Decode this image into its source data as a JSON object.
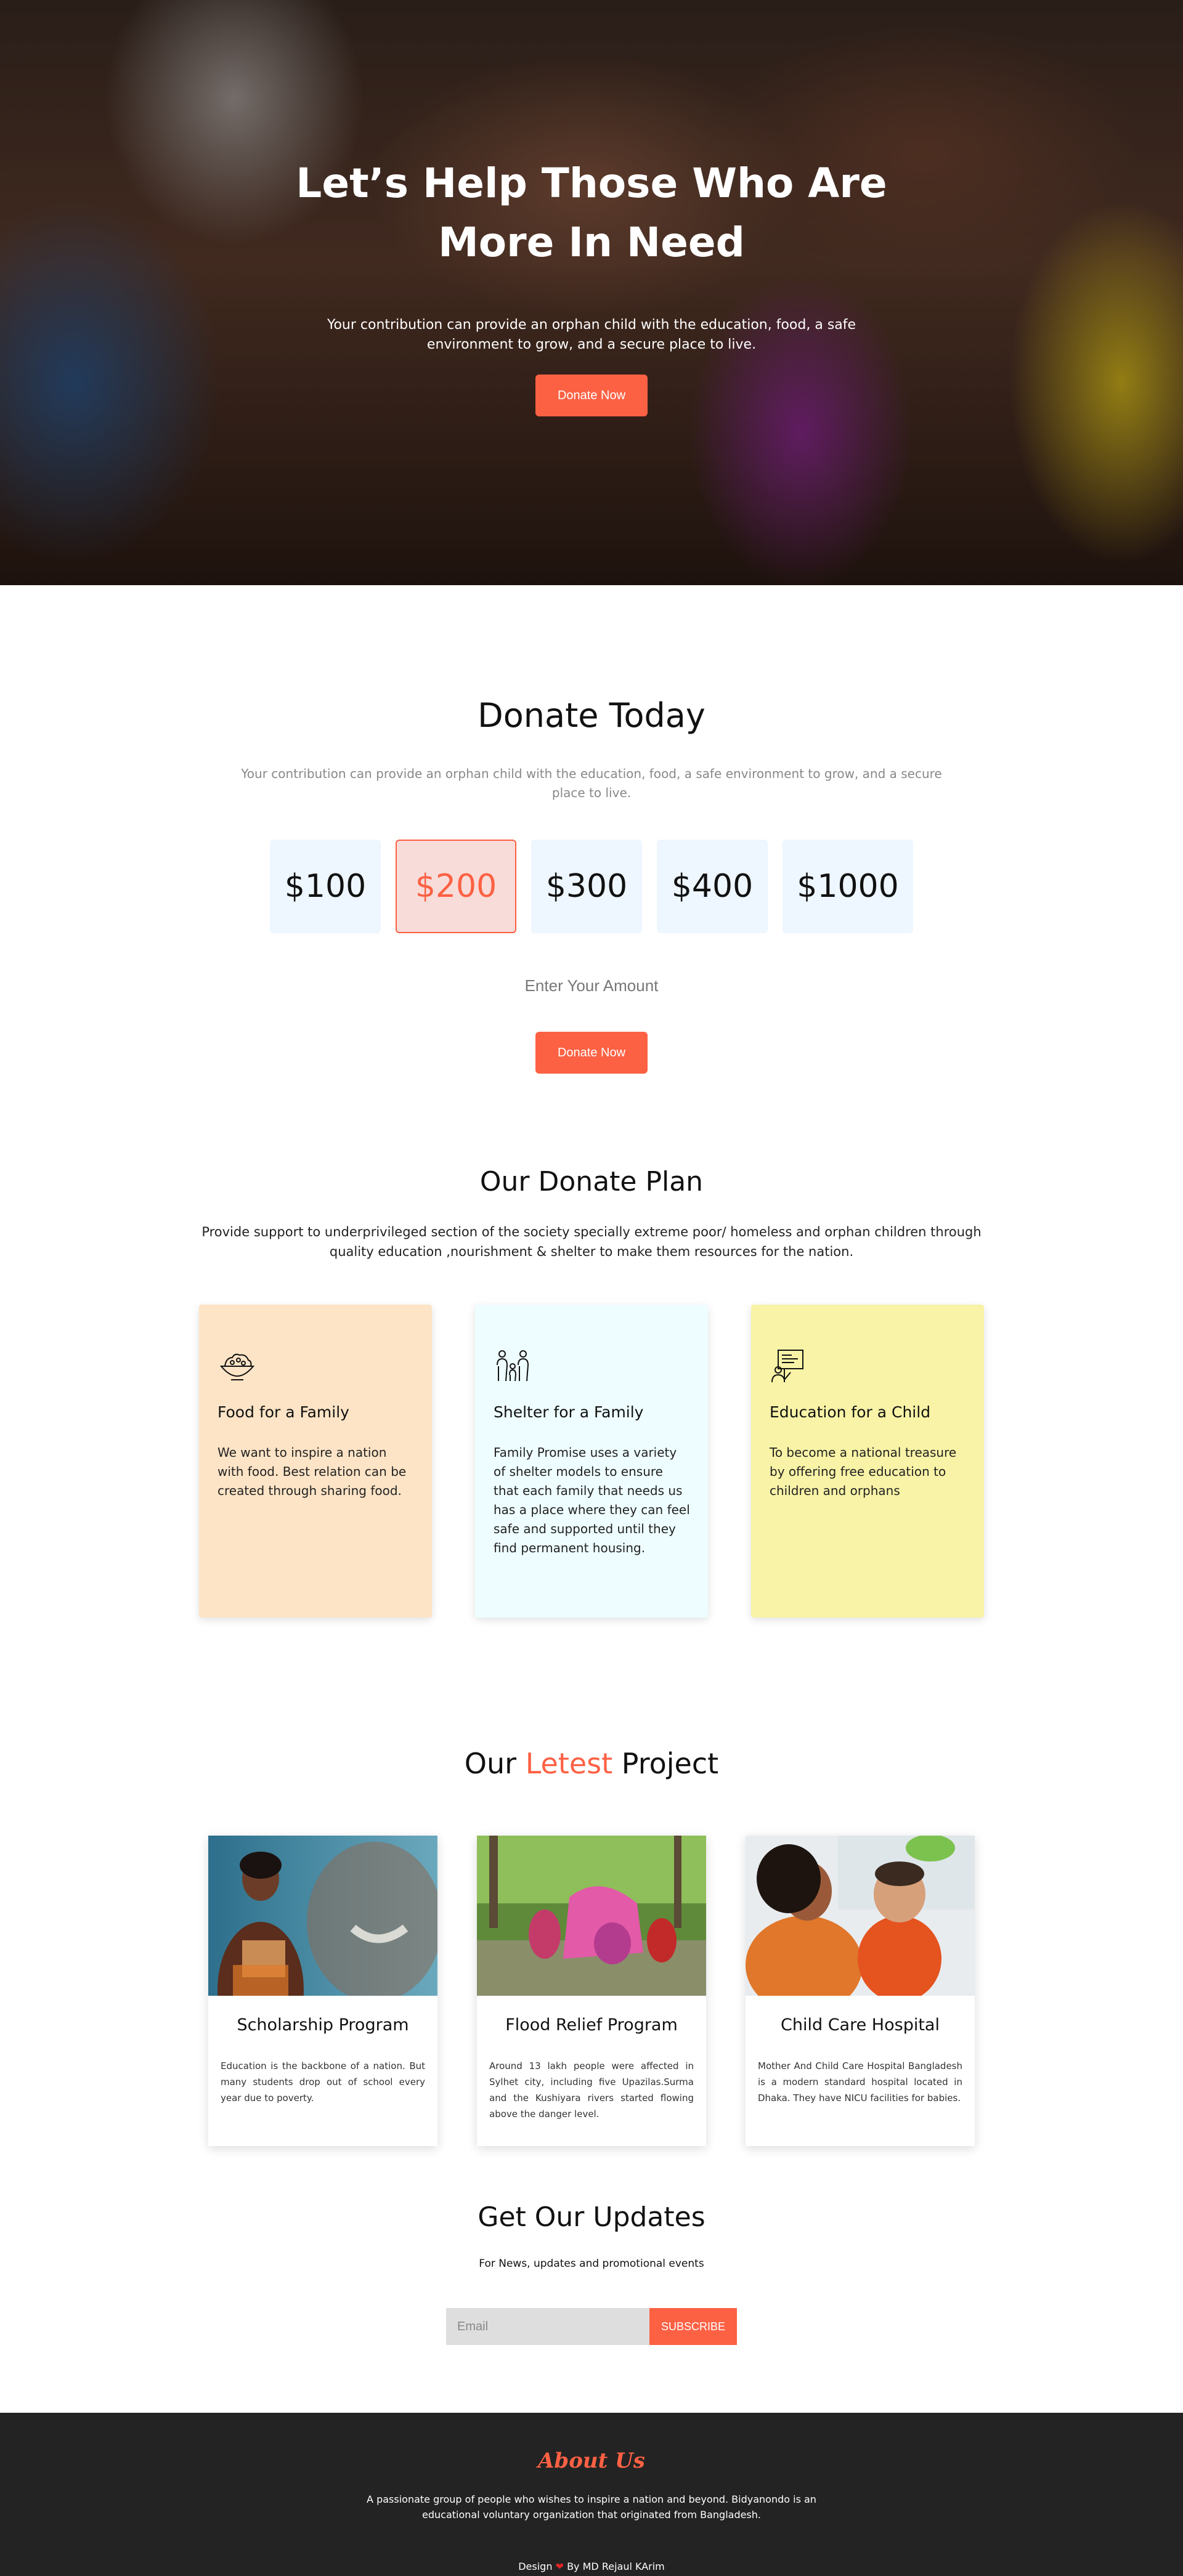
{
  "hero": {
    "title": "Let’s Help Those Who Are More In Need",
    "subtitle": "Your contribution can provide an orphan child with the education, food, a safe environment to grow, and a secure place to live.",
    "button": "Donate Now"
  },
  "donate": {
    "title": "Donate Today",
    "subtitle": "Your contribution can provide an orphan child with the education, food, a safe environment to grow, and a secure place to live.",
    "amounts": [
      "$100",
      "$200",
      "$300",
      "$400",
      "$1000"
    ],
    "selected": "$200",
    "input_placeholder": "Enter Your Amount",
    "button": "Donate Now"
  },
  "plan": {
    "title": "Our Donate Plan",
    "subtitle": "Provide support to underprivileged section of the society specially extreme poor/ homeless and orphan children through quality education ,nourishment & shelter to make them resources for the nation.",
    "cards": [
      {
        "title": "Food for a Family",
        "text": "We want to inspire a nation with food. Best relation can be created through sharing food.",
        "icon": "food-bowl-icon",
        "color": "#fde4c6"
      },
      {
        "title": "Shelter for a Family",
        "text": "Family Promise uses a variety of shelter models to ensure that each family that needs us has a place where they can feel safe and supported until they find permanent housing.",
        "icon": "family-icon",
        "color": "#eefdff"
      },
      {
        "title": "Education for a Child",
        "text": "To become a national treasure by offering free education to children and orphans",
        "icon": "education-board-icon",
        "color": "#f8f3a6"
      }
    ]
  },
  "projects": {
    "title_before": "Our ",
    "title_accent": "Letest",
    "title_after": " Project",
    "cards": [
      {
        "title": "Scholarship Program",
        "text": "Education is the backbone of a nation. But many students drop out of school every year due to poverty."
      },
      {
        "title": "Flood Relief Program",
        "text": "Around 13 lakh people were affected in Sylhet city, including five Upazilas.Surma and the Kushiyara rivers started flowing above the danger level."
      },
      {
        "title": "Child Care Hospital",
        "text": "Mother And Child Care Hospital Bangladesh is a modern standard hospital located in Dhaka. They have NICU facilities for babies."
      }
    ]
  },
  "updates": {
    "title": "Get Our Updates",
    "subtitle": "For News, updates and promotional events",
    "email_placeholder": "Email",
    "button": "SUBSCRIBE"
  },
  "footer": {
    "title": "About Us",
    "text": "A passionate group of people who wishes to inspire a nation and beyond. Bidyanondo is an educational voluntary organization that originated from Bangladesh.",
    "credit_before": "Design",
    "credit_after": "By MD Rejaul KArim"
  },
  "colors": {
    "accent": "#fd6144",
    "footer_bg": "#232323",
    "amount_bg": "#eef6ff"
  }
}
